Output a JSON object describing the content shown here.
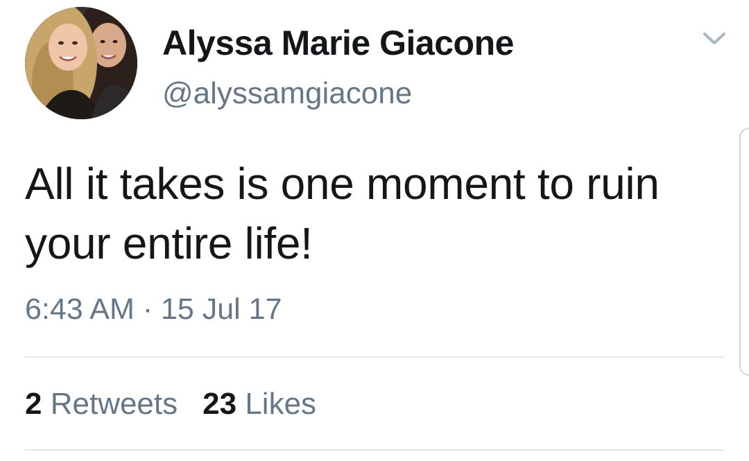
{
  "author": {
    "display_name": "Alyssa Marie Giacone",
    "handle": "@alyssamgiacone"
  },
  "tweet": {
    "text": "All it takes is one moment to ruin your entire life!",
    "timestamp": "6:43 AM · 15 Jul 17"
  },
  "stats": {
    "retweets_count": "2",
    "retweets_label": "Retweets",
    "likes_count": "23",
    "likes_label": "Likes"
  },
  "icons": {
    "menu": "chevron-down-icon"
  },
  "colors": {
    "text_primary": "#14171a",
    "text_secondary": "#657786",
    "divider": "#e1e8ed"
  }
}
